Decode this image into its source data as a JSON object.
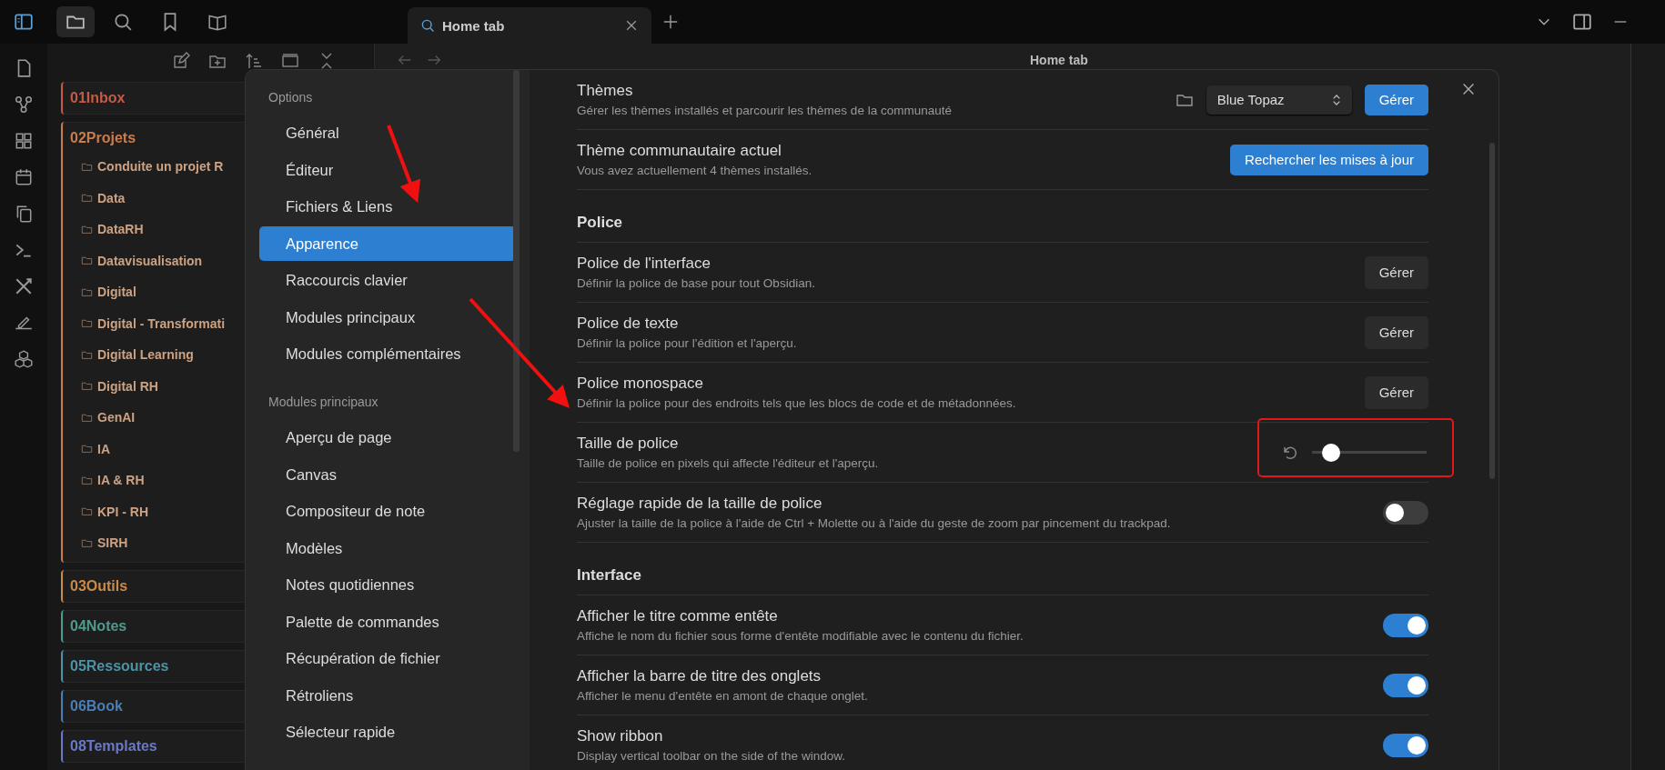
{
  "sidebar_tabs": [
    {
      "kind": "files",
      "selected": true
    },
    {
      "kind": "search",
      "selected": false
    },
    {
      "kind": "bookmarks",
      "selected": false
    },
    {
      "kind": "reading",
      "selected": false
    }
  ],
  "tabs": [
    {
      "title": "Home tab"
    }
  ],
  "view_header": {
    "title": "Home tab"
  },
  "file_tree": [
    {
      "name": "01Inbox",
      "color": "#c65a45"
    },
    {
      "name": "02Projets",
      "color": "#c97c4c",
      "children": [
        {
          "name": "Conduite un projet R"
        },
        {
          "name": "Data"
        },
        {
          "name": "DataRH"
        },
        {
          "name": "Datavisualisation"
        },
        {
          "name": "Digital"
        },
        {
          "name": "Digital - Transformati"
        },
        {
          "name": "Digital Learning"
        },
        {
          "name": "Digital RH"
        },
        {
          "name": "GenAI"
        },
        {
          "name": "IA"
        },
        {
          "name": "IA & RH"
        },
        {
          "name": "KPI - RH"
        },
        {
          "name": "SIRH"
        }
      ]
    },
    {
      "name": "03Outils",
      "color": "#c98a4a"
    },
    {
      "name": "04Notes",
      "color": "#4f9a8f"
    },
    {
      "name": "05Ressources",
      "color": "#4a94a8"
    },
    {
      "name": "06Book",
      "color": "#4a7fb5"
    },
    {
      "name": "08Templates",
      "color": "#6a78c8"
    }
  ],
  "settings": {
    "nav": [
      {
        "heading": "Options",
        "items": [
          {
            "label": "Général",
            "selected": false
          },
          {
            "label": "Éditeur",
            "selected": false
          },
          {
            "label": "Fichiers & Liens",
            "selected": false
          },
          {
            "label": "Apparence",
            "selected": true
          },
          {
            "label": "Raccourcis clavier",
            "selected": false
          },
          {
            "label": "Modules principaux",
            "selected": false
          },
          {
            "label": "Modules complémentaires",
            "selected": false
          }
        ]
      },
      {
        "heading": "Modules principaux",
        "items": [
          {
            "label": "Aperçu de page",
            "selected": false
          },
          {
            "label": "Canvas",
            "selected": false
          },
          {
            "label": "Compositeur de note",
            "selected": false
          },
          {
            "label": "Modèles",
            "selected": false
          },
          {
            "label": "Notes quotidiennes",
            "selected": false
          },
          {
            "label": "Palette de commandes",
            "selected": false
          },
          {
            "label": "Récupération de fichier",
            "selected": false
          },
          {
            "label": "Rétroliens",
            "selected": false
          },
          {
            "label": "Sélecteur rapide",
            "selected": false
          }
        ]
      }
    ],
    "rows": [
      {
        "kind": "theme",
        "title": "Thèmes",
        "description": "Gérer les thèmes installés et parcourir les thèmes de la communauté",
        "select": "Blue Topaz",
        "button": {
          "label": "Gérer",
          "primary": true
        }
      },
      {
        "kind": "button",
        "title": "Thème communautaire actuel",
        "description": "Vous avez actuellement 4 thèmes installés.",
        "button": {
          "label": "Rechercher les mises à jour",
          "primary": true
        }
      },
      {
        "kind": "heading",
        "title": "Police"
      },
      {
        "kind": "button",
        "title": "Police de l'interface",
        "description": "Définir la police de base pour tout Obsidian.",
        "button": {
          "label": "Gérer",
          "primary": false
        }
      },
      {
        "kind": "button",
        "title": "Police de texte",
        "description": "Définir la police pour l'édition et l'aperçu.",
        "button": {
          "label": "Gérer",
          "primary": false
        }
      },
      {
        "kind": "button",
        "title": "Police monospace",
        "description": "Définir la police pour des endroits tels que les blocs de code et de métadonnées.",
        "button": {
          "label": "Gérer",
          "primary": false
        }
      },
      {
        "kind": "slider",
        "title": "Taille de police",
        "description": "Taille de police en pixels qui affecte l'éditeur et l'aperçu.",
        "level": 0.17
      },
      {
        "kind": "toggle",
        "title": "Réglage rapide de la taille de police",
        "description": "Ajuster la taille de la police à l'aide de Ctrl + Molette ou à l'aide du geste de zoom par pincement du trackpad.",
        "on": false
      },
      {
        "kind": "heading",
        "title": "Interface"
      },
      {
        "kind": "toggle",
        "title": "Afficher le titre comme entête",
        "description": "Affiche le nom du fichier sous forme d'entête modifiable avec le contenu du fichier.",
        "on": true
      },
      {
        "kind": "toggle",
        "title": "Afficher la barre de titre des onglets",
        "description": "Afficher le menu d'entête en amont de chaque onglet.",
        "on": true
      },
      {
        "kind": "toggle",
        "title": "Show ribbon",
        "description": "Display vertical toolbar on the side of the window.",
        "on": true
      }
    ]
  }
}
